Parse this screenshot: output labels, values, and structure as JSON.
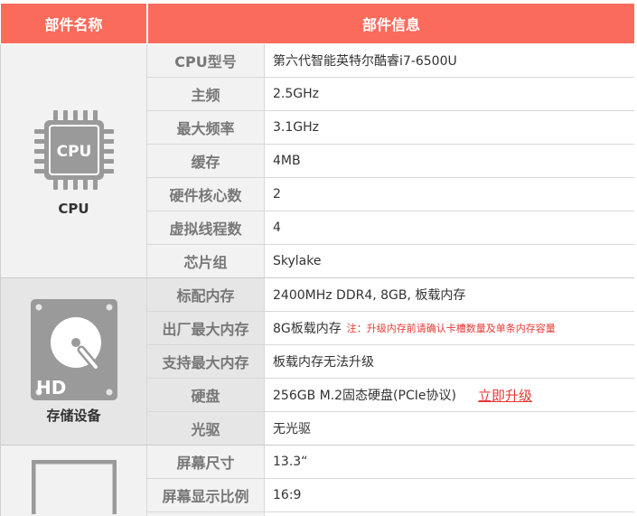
{
  "header": {
    "col1": "部件名称",
    "col2": "部件信息"
  },
  "groups": [
    {
      "label": "CPU",
      "icon": "cpu-chip-icon",
      "icon_text": "CPU",
      "bg": "#f2f2f2"
    },
    {
      "label": "存储设备",
      "icon": "hard-drive-icon",
      "icon_text": "HD",
      "bg": "#e6e6e6"
    },
    {
      "label": "",
      "icon": "display-screen-icon",
      "bg": "#f2f2f2"
    }
  ],
  "rows": [
    {
      "label": "CPU型号",
      "value": "第六代智能英特尔酷睿i7-6500U"
    },
    {
      "label": "主频",
      "value": "2.5GHz"
    },
    {
      "label": "最大频率",
      "value": "3.1GHz"
    },
    {
      "label": "缓存",
      "value": "4MB"
    },
    {
      "label": "硬件核心数",
      "value": "2"
    },
    {
      "label": "虚拟线程数",
      "value": "4"
    },
    {
      "label": "芯片组",
      "value": "Skylake"
    },
    {
      "label": "标配内存",
      "value": "2400MHz DDR4, 8GB, 板载内存"
    },
    {
      "label": "出厂最大内存",
      "value": "8G板载内存",
      "note": "注：升级内存前请确认卡槽数量及单条内存容量"
    },
    {
      "label": "支持最大内存",
      "value": "板载内存无法升级"
    },
    {
      "label": "硬盘",
      "value": "256GB M.2固态硬盘(PCIe协议)",
      "link": "立即升级"
    },
    {
      "label": "光驱",
      "value": "无光驱"
    },
    {
      "label": "屏幕尺寸",
      "value": "13.3“"
    },
    {
      "label": "屏幕显示比例",
      "value": "16:9"
    }
  ],
  "colors": {
    "header_bg": "#fb6b5b",
    "accent_red": "#e53935"
  }
}
